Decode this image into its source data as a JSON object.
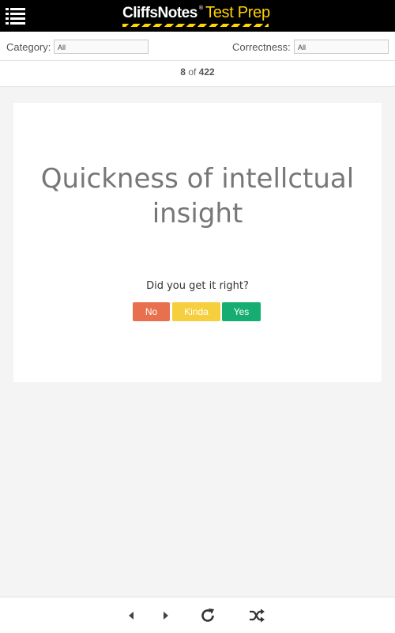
{
  "header": {
    "brand_name": "CliffsNotes",
    "brand_reg": "®",
    "brand_tag": "Test Prep",
    "menu_icon": "list-menu-icon",
    "colors": {
      "background": "#000000",
      "accent": "#ffd400"
    }
  },
  "filters": {
    "category_label": "Category:",
    "category_value": "All",
    "correctness_label": "Correctness:",
    "correctness_value": "All"
  },
  "counter": {
    "current": "8",
    "of_text": "of",
    "total": "422"
  },
  "card": {
    "term_line1": "Quickness of intellctual",
    "term_line2": "insight",
    "prompt": "Did you get it right?",
    "buttons": [
      {
        "label": "No",
        "color": "#e8704f"
      },
      {
        "label": "Kinda",
        "color": "#f5cf3d"
      },
      {
        "label": "Yes",
        "color": "#16ae70"
      }
    ]
  },
  "toolbar": {
    "icons": [
      "previous-icon",
      "next-icon",
      "restart-icon",
      "shuffle-icon"
    ]
  }
}
